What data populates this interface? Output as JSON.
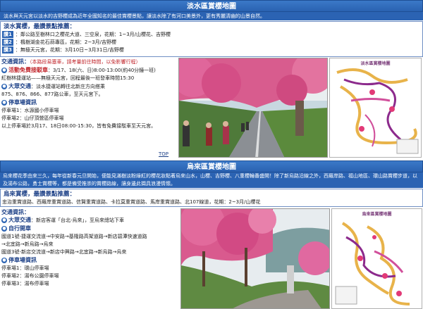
{
  "danshui": {
    "title": "淡水區賞櫻地圖",
    "intro": "淡水與天元宮以淡水的吉野櫻成為近年全國知名的最佳賞櫻景點，讓淡水除了有河口美景外，更有秀麗清幽的山景自然。",
    "spots_title": "淡水賞櫻，最讚景點推薦：",
    "spots": [
      {
        "tag": "讚1",
        "text": "：鄰公路至樹林口之櫻花大道、三空泉，花期：1~3月/山櫻花、吉野櫻"
      },
      {
        "tag": "讚2",
        "text": "：楓樹湖金花石蒜專區，花期：2~3月/吉野櫻"
      },
      {
        "tag": "讚3",
        "text": "：無極天元宮，花期：3月10日~3月31日/吉野櫻"
      }
    ],
    "traffic_heading": "交通資訊：",
    "traffic_note": "（本路段易塞車，請考量前往時間，以免影響行程）",
    "shuttle_title": "活動免費接駁車",
    "shuttle_dates": "：3/17、18(六、日)8:00-13:00(約40分鐘一班)",
    "shuttle_route": "紅樹林捷運站——無極天元宮，回程最後一班發車時間15:30",
    "public_title": "大眾交通",
    "public_text": "：淡水捷運站轉往北新庄方向搭乘",
    "bus_routes": "875、876、866、877路公車，至天元宮下。",
    "parking_title": "停車場資訊",
    "parking": [
      "停車場1：水源國小停車場",
      "停車場2：山仔頂營區停車場",
      "以上停車場於3月17、18日08:00-15:30，皆有免費接駁車至天元宮。"
    ],
    "top_label": "TOP",
    "map_title": "淡水區賞櫻地圖"
  },
  "wulai": {
    "title": "烏來區賞櫻地圖",
    "intro": "烏來櫻花季由來三久，每年從新春元旦開始，便能見滿樹淡粉綠紅的櫻花妝點著烏來山水，山櫻、吉野櫻、八重櫻輪番盛開！除了新烏路沿線之外，西羅岸路、福山地區、環山路賞櫻步道，以及湯布公路，勇士賞櫻等，都是備受推崇的賞櫻路線，讓身邊此擷具浪漫情懷。",
    "spots_title": "烏來賞櫻，最讚景點推薦：",
    "spots_text": "忠治重賞道路、西羅岸重賞道路、信賢重賞道路、卡拉莫重賞道路、馬岸重賞道路、北107線道，花期：2~3月/山櫻花",
    "traffic_heading": "交通資訊：",
    "public_title": "大眾交通",
    "public_text": "：新店客運「台北-烏來」，至烏來總站下車",
    "drive_title": "自行開車",
    "drive_routes": [
      "國道1號-捷運交流道→中安路→基隆路高架道路→新店碧潭快速道路",
      "→北宜路→新烏路→烏來",
      "國道3號-新店交流道→新店中興路→北宜路→新烏路→烏來"
    ],
    "parking_title": "停車場資訊",
    "parking": [
      "停車場1：環山停車場",
      "停車場2：湯布公園停車場",
      "停車場3：湯布停車場"
    ],
    "map_title": "烏來區賞櫻地圖"
  },
  "colors": {
    "header_blue": "#2b63b3",
    "label_red": "#c0252b",
    "sakura_pink": "#e23a77"
  }
}
